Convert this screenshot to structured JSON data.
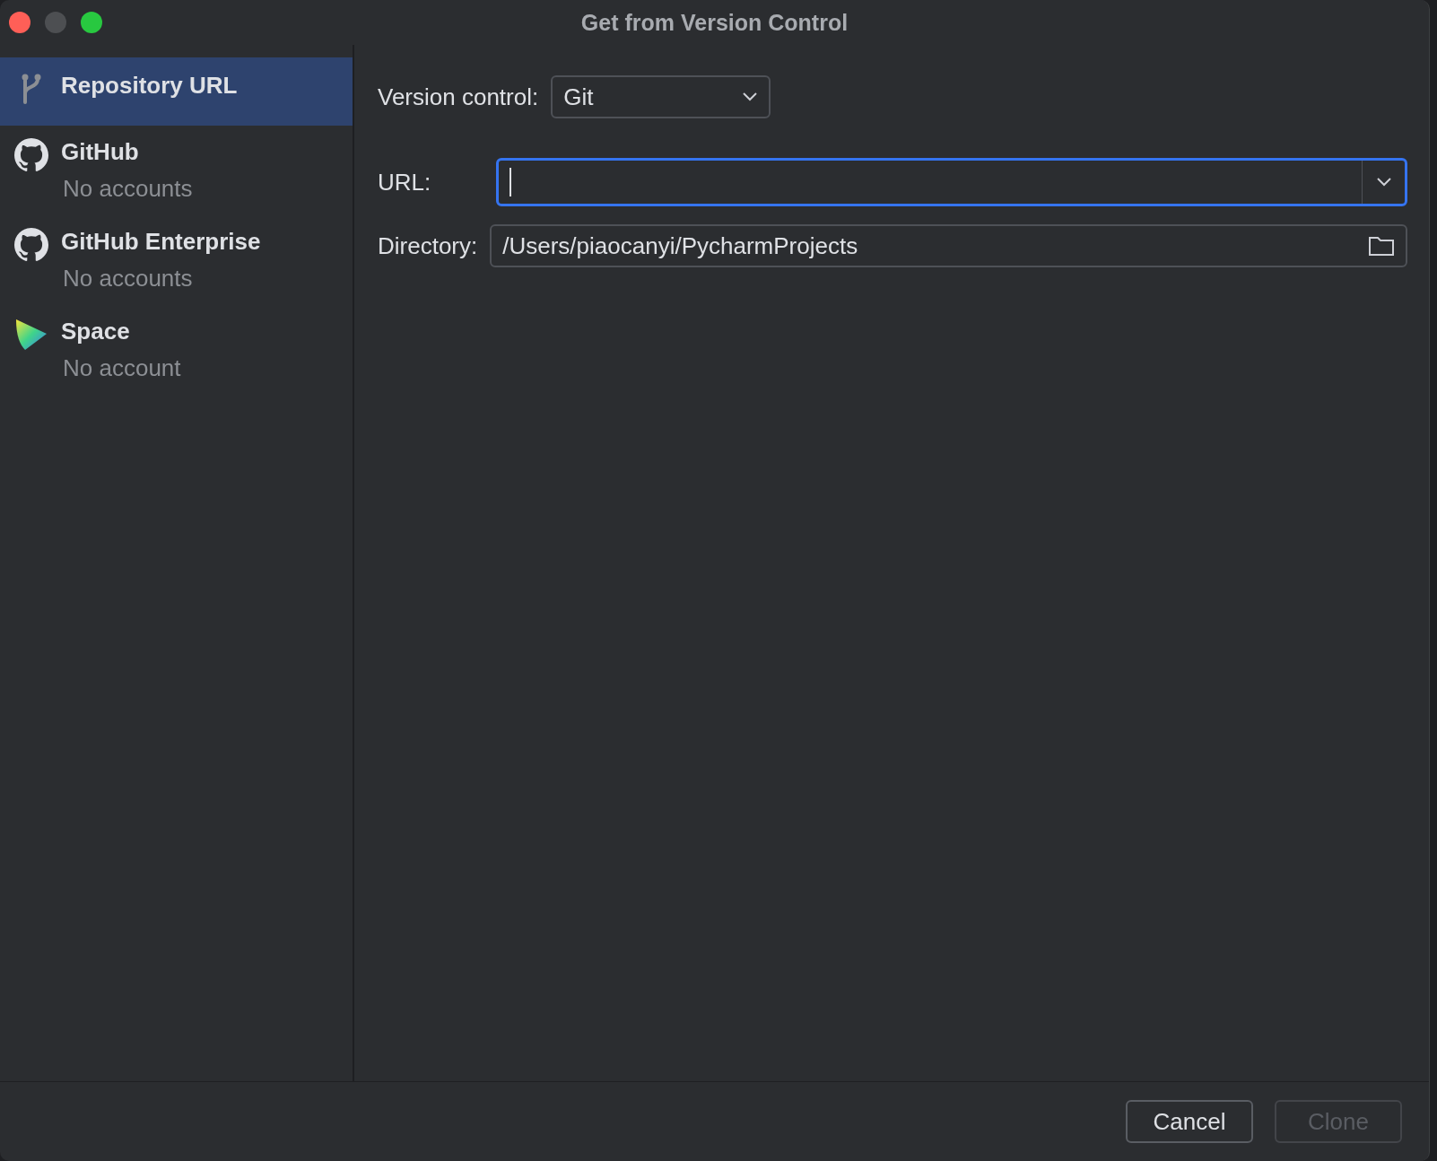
{
  "window": {
    "title": "Get from Version Control"
  },
  "sidebar": {
    "items": [
      {
        "kind": "url",
        "label": "Repository URL",
        "selected": true
      },
      {
        "kind": "github",
        "label": "GitHub",
        "subtitle": "No accounts",
        "selected": false
      },
      {
        "kind": "github",
        "label": "GitHub Enterprise",
        "subtitle": "No accounts",
        "selected": false
      },
      {
        "kind": "space",
        "label": "Space",
        "subtitle": "No account",
        "selected": false
      }
    ]
  },
  "form": {
    "version_control": {
      "label": "Version control:",
      "value": "Git"
    },
    "url": {
      "label": "URL:",
      "focused": true
    },
    "directory": {
      "label": "Directory:",
      "value": "/Users/piaocanyi/PycharmProjects"
    }
  },
  "buttons": [
    {
      "label": "Cancel",
      "disabled": false
    },
    {
      "label": "Clone",
      "disabled": true
    }
  ]
}
